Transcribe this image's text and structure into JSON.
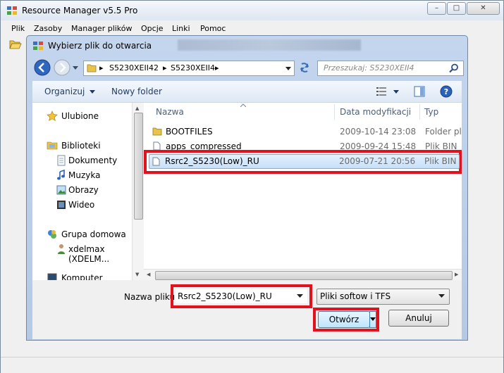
{
  "app": {
    "title": "Resource Manager v5.5 Pro"
  },
  "menu": [
    "Plik",
    "Zasoby",
    "Manager plików",
    "Opcje",
    "Linki",
    "Pomoc"
  ],
  "dialog": {
    "title": "Wybierz plik do otwarcia",
    "breadcrumbs": [
      "S5230XEII42",
      "S5230XEII4"
    ],
    "search_placeholder": "Przeszukaj: S5230XEII4",
    "toolbar": {
      "organize": "Organizuj",
      "new_folder": "Nowy folder"
    },
    "nav": {
      "favorites": "Ulubione",
      "libraries": "Biblioteki",
      "lib_items": [
        "Dokumenty",
        "Muzyka",
        "Obrazy",
        "Wideo"
      ],
      "homegroup": "Grupa domowa",
      "user": "xdelmax (XDELM...",
      "computer": "Komputer"
    },
    "columns": {
      "name": "Nazwa",
      "date": "Data modyfikacji",
      "type": "Typ"
    },
    "files": [
      {
        "name": "BOOTFILES",
        "date": "2009-10-14 23:08",
        "type": "Folder plików",
        "icon": "folder-icon"
      },
      {
        "name": "apps_compressed",
        "date": "2009-09-24 15:48",
        "type": "Plik BIN",
        "icon": "file-icon"
      },
      {
        "name": "Rsrc2_S5230(Low)_RU",
        "date": "2009-07-21 20:56",
        "type": "Plik BIN",
        "icon": "file-icon",
        "selected": true
      }
    ],
    "filename_label": "Nazwa pliku:",
    "filename_value": "Rsrc2_S5230(Low)_RU",
    "filter_value": "Pliki softow i TFS",
    "open_label": "Otwórz",
    "cancel_label": "Anuluj"
  },
  "colors": {
    "highlight": "#e3101e",
    "selection": "#cde8ff"
  }
}
